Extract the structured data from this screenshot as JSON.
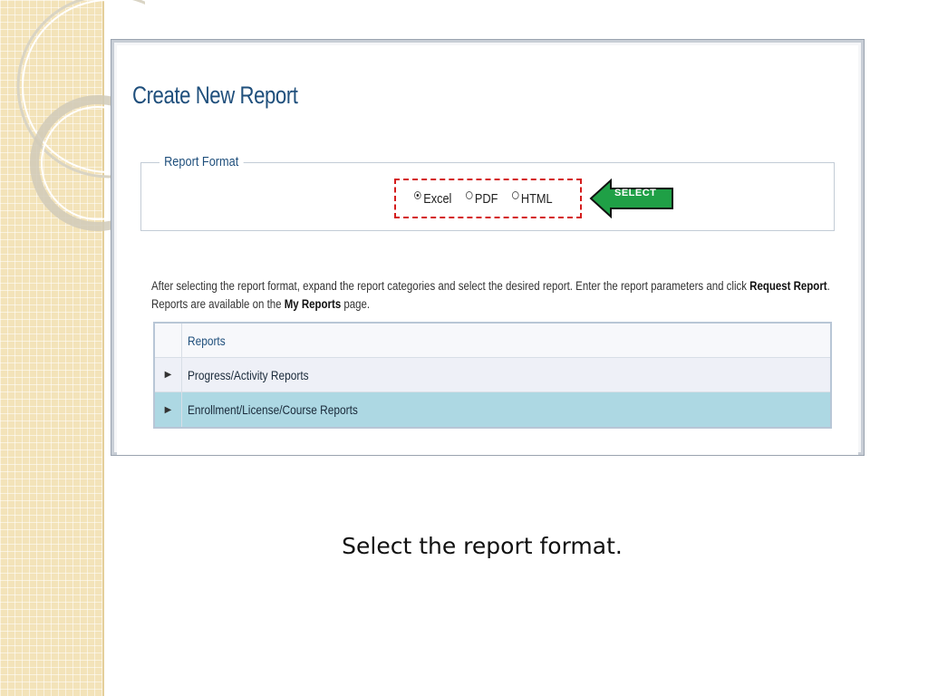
{
  "page": {
    "title": "Create New Report",
    "caption": "Select the report format."
  },
  "report_format": {
    "legend": "Report Format",
    "options": [
      {
        "label": "Excel",
        "checked": true
      },
      {
        "label": "PDF",
        "checked": false
      },
      {
        "label": "HTML",
        "checked": false
      }
    ],
    "callout_label": "SELECT",
    "callout_color": "#1fa046",
    "highlight_color": "#d41c1c"
  },
  "instructions": {
    "line1_text": "After selecting the report format, expand the report categories and select the desired report. Enter the report parameters and click ",
    "line1_bold": "Request Report",
    "line1_end": ".",
    "line2_text": "Reports are available on the ",
    "line2_bold": "My Reports",
    "line2_end": " page."
  },
  "reports_table": {
    "header": "Reports",
    "rows": [
      {
        "label": "Progress/Activity Reports",
        "icon": "expand-arrow-icon"
      },
      {
        "label": "Enrollment/License/Course Reports",
        "icon": "expand-arrow-icon",
        "selected": true
      }
    ]
  }
}
